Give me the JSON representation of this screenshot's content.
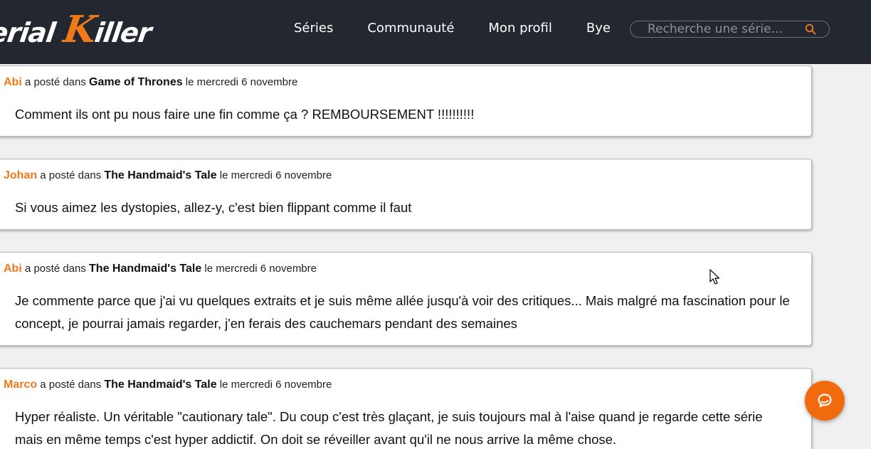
{
  "header": {
    "logo": {
      "part1": "erial",
      "accent": "K",
      "part2": "iller"
    },
    "nav": [
      {
        "label": "Séries"
      },
      {
        "label": "Communauté"
      },
      {
        "label": "Mon profil"
      },
      {
        "label": "Bye"
      }
    ],
    "search": {
      "placeholder": "Recherche une série...",
      "icon": "search-icon"
    }
  },
  "posts": [
    {
      "author": "Abi",
      "posted_in": "a posté dans",
      "series": "Game of Thrones",
      "date": "le mercredi 6 novembre",
      "body": "Comment ils ont pu nous faire une fin comme ça ? REMBOURSEMENT !!!!!!!!!!"
    },
    {
      "author": "Johan",
      "posted_in": "a posté dans",
      "series": "The Handmaid's Tale",
      "date": "le mercredi 6 novembre",
      "body": "Si vous aimez les dystopies, allez-y, c'est bien flippant comme il faut"
    },
    {
      "author": "Abi",
      "posted_in": "a posté dans",
      "series": "The Handmaid's Tale",
      "date": "le mercredi 6 novembre",
      "body": "Je commente parce que j'ai vu quelques extraits et je suis même allée jusqu'à voir des critiques... Mais malgré ma fascination pour le concept, je pourrai jamais regarder, j'en ferais des cauchemars pendant des semaines"
    },
    {
      "author": "Marco",
      "posted_in": "a posté dans",
      "series": "The Handmaid's Tale",
      "date": "le mercredi 6 novembre",
      "body": "Hyper réaliste. Un véritable \"cautionary tale\". Du coup c'est très glaçant, je suis toujours mal à l'aise quand je regarde cette série mais en même temps c'est hyper addictif. On doit se réveiller avant qu'il ne nous arrive la même chose."
    }
  ],
  "chat": {
    "icon": "chat-bubble-icon"
  },
  "colors": {
    "header_bg": "#23272f",
    "accent": "#f07a1a",
    "fab": "#f26a0e",
    "page_bg": "#f0f0f0"
  }
}
